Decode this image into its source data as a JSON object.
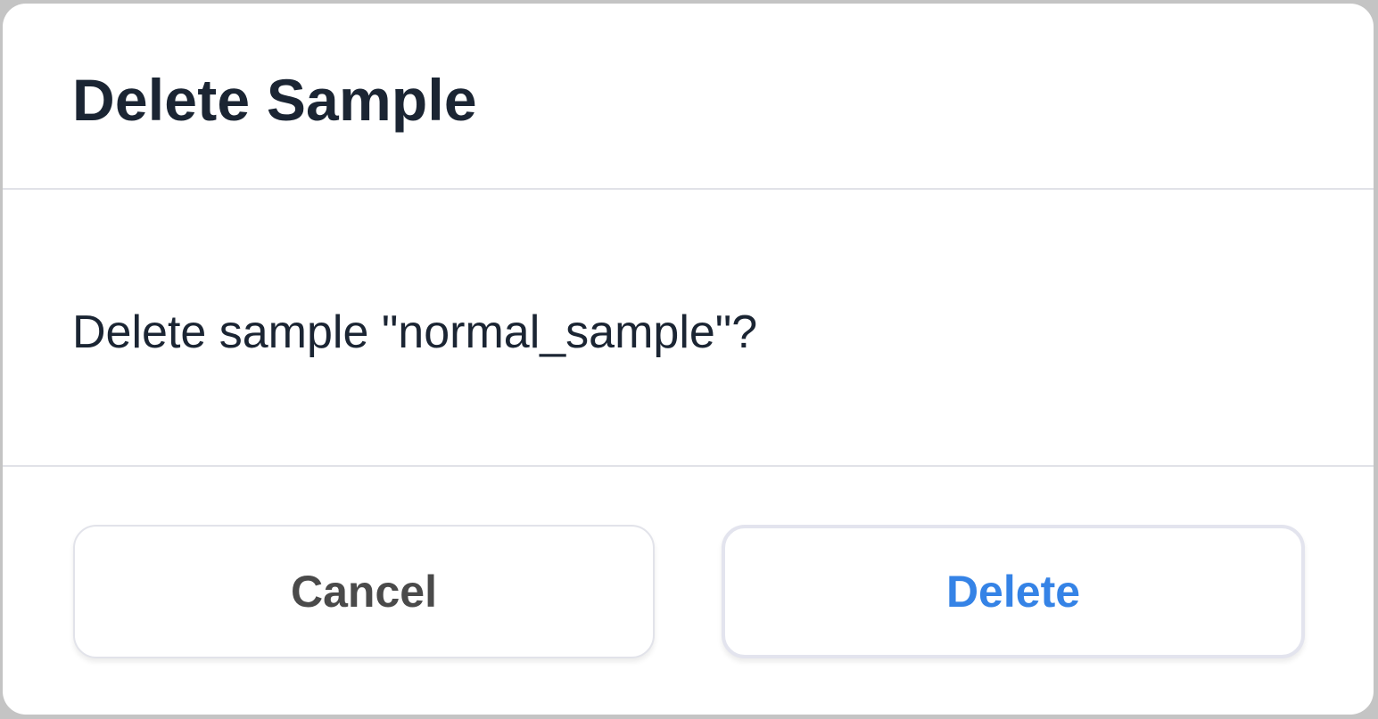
{
  "dialog": {
    "title": "Delete Sample",
    "message": "Delete sample \"normal_sample\"?",
    "cancel_label": "Cancel",
    "delete_label": "Delete"
  },
  "colors": {
    "title_text": "#1b2533",
    "cancel_text": "#4a4a4a",
    "delete_text": "#3583e6",
    "divider": "#e1e2e8"
  }
}
